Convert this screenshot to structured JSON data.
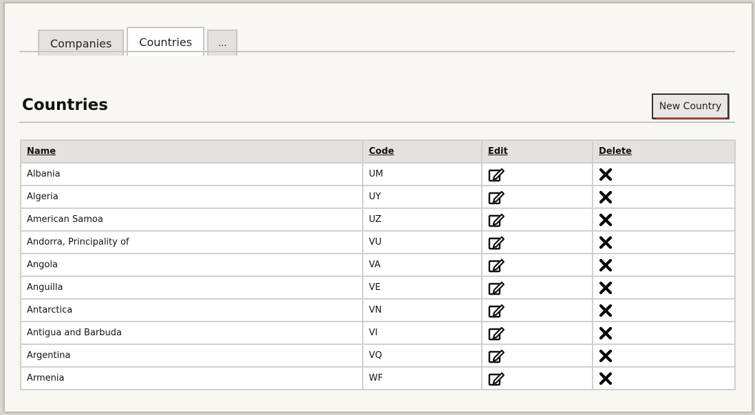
{
  "tabs": [
    {
      "label": "Companies",
      "active": false
    },
    {
      "label": "Countries",
      "active": true
    },
    {
      "label": "...",
      "active": false
    }
  ],
  "page": {
    "title": "Countries",
    "new_button_label": "New Country"
  },
  "table": {
    "columns": [
      "Name",
      "Code",
      "Edit",
      "Delete"
    ],
    "rows": [
      {
        "name": "Albania",
        "code": "UM"
      },
      {
        "name": "Algeria",
        "code": "UY"
      },
      {
        "name": "American Samoa",
        "code": "UZ"
      },
      {
        "name": "Andorra, Principality of",
        "code": "VU"
      },
      {
        "name": "Angola",
        "code": "VA"
      },
      {
        "name": "Anguilla",
        "code": "VE"
      },
      {
        "name": "Antarctica",
        "code": "VN"
      },
      {
        "name": "Antigua and Barbuda",
        "code": "VI"
      },
      {
        "name": "Argentina",
        "code": "VQ"
      },
      {
        "name": "Armenia",
        "code": "WF"
      }
    ],
    "row_icons": {
      "edit": "edit-icon",
      "delete": "close-icon"
    }
  },
  "colors": {
    "accent_underline": "#c0262a"
  }
}
